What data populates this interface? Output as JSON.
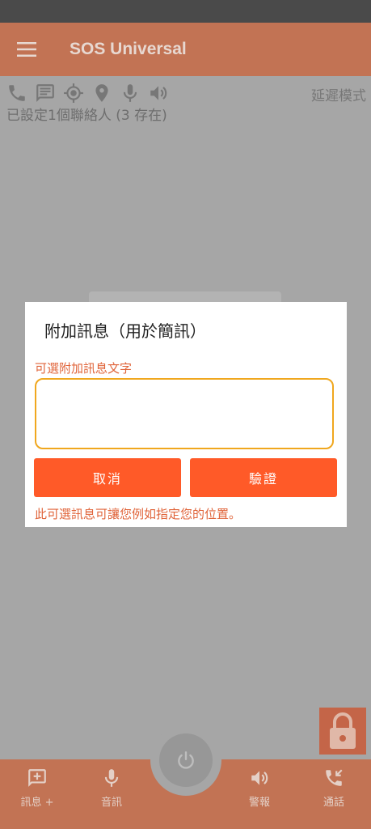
{
  "app": {
    "title": "SOS Universal"
  },
  "header": {
    "mode_label": "延遲模式",
    "contacts_status": "已設定1個聯絡人 (3 存在)"
  },
  "status_icons": [
    "phone-icon",
    "message-icon",
    "gps-icon",
    "location-pin-icon",
    "microphone-icon",
    "speaker-icon"
  ],
  "dialog": {
    "title": "附加訊息（用於簡訊）",
    "hint": "可選附加訊息文字",
    "input_value": "",
    "cancel_label": "取消",
    "verify_label": "驗證",
    "note": "此可選訊息可讓您例如指定您的位置。"
  },
  "bottom_nav": {
    "message": "訊息 +",
    "audio": "音訊",
    "alarm": "警報",
    "call": "通話"
  },
  "colors": {
    "primary": "#c27354",
    "accent": "#ff5a28",
    "input_border": "#f0a71e",
    "hint_text": "#e0643a"
  }
}
